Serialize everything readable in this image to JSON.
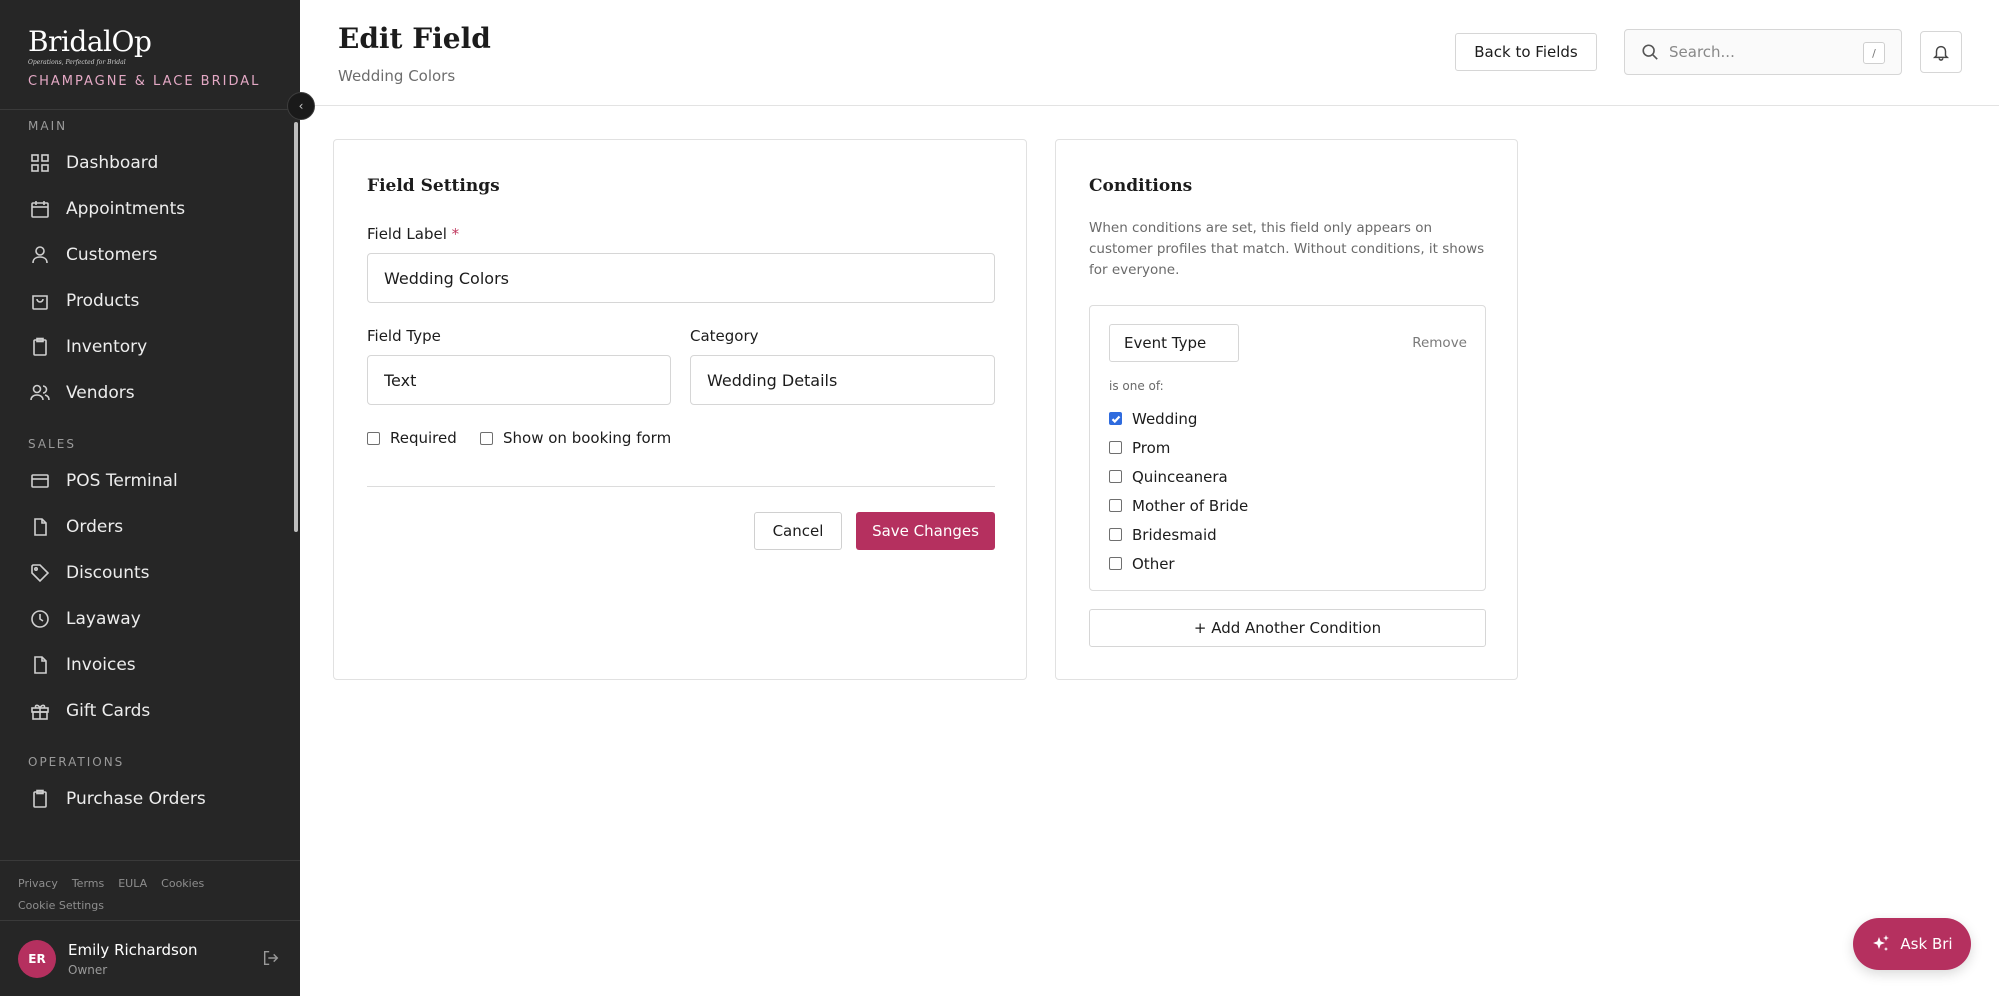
{
  "sidebar": {
    "logo": "BridalOp",
    "tagline": "Operations, Perfected for Bridal",
    "store_name": "CHAMPAGNE & LACE BRIDAL",
    "sections": [
      {
        "label": "MAIN",
        "items": [
          {
            "label": "Dashboard",
            "icon": "grid-icon"
          },
          {
            "label": "Appointments",
            "icon": "calendar-icon"
          },
          {
            "label": "Customers",
            "icon": "user-icon"
          },
          {
            "label": "Products",
            "icon": "shopping-bag-icon"
          },
          {
            "label": "Inventory",
            "icon": "clipboard-icon"
          },
          {
            "label": "Vendors",
            "icon": "users-icon"
          }
        ]
      },
      {
        "label": "SALES",
        "items": [
          {
            "label": "POS Terminal",
            "icon": "credit-card-icon"
          },
          {
            "label": "Orders",
            "icon": "document-icon"
          },
          {
            "label": "Discounts",
            "icon": "tag-icon"
          },
          {
            "label": "Layaway",
            "icon": "clock-icon"
          },
          {
            "label": "Invoices",
            "icon": "file-icon"
          },
          {
            "label": "Gift Cards",
            "icon": "gift-icon"
          }
        ]
      },
      {
        "label": "OPERATIONS",
        "items": [
          {
            "label": "Purchase Orders",
            "icon": "clipboard-icon"
          }
        ]
      }
    ],
    "legal": [
      "Privacy",
      "Terms",
      "EULA",
      "Cookies"
    ],
    "cookie_settings": "Cookie Settings",
    "user": {
      "initials": "ER",
      "name": "Emily Richardson",
      "role": "Owner"
    }
  },
  "header": {
    "title": "Edit Field",
    "subtitle": "Wedding Colors",
    "back_label": "Back to Fields",
    "search_placeholder": "Search...",
    "search_shortcut": "/"
  },
  "field_settings": {
    "title": "Field Settings",
    "label_label": "Field Label",
    "required_mark": "*",
    "label_value": "Wedding Colors",
    "type_label": "Field Type",
    "type_value": "Text",
    "category_label": "Category",
    "category_value": "Wedding Details",
    "required_label": "Required",
    "required_checked": false,
    "booking_label": "Show on booking form",
    "booking_checked": false,
    "cancel_label": "Cancel",
    "save_label": "Save Changes"
  },
  "conditions": {
    "title": "Conditions",
    "description": "When conditions are set, this field only appears on customer profiles that match. Without conditions, it shows for everyone.",
    "condition": {
      "attribute": "Event Type",
      "remove_label": "Remove",
      "operator": "is one of:",
      "options": [
        {
          "label": "Wedding",
          "checked": true
        },
        {
          "label": "Prom",
          "checked": false
        },
        {
          "label": "Quinceanera",
          "checked": false
        },
        {
          "label": "Mother of Bride",
          "checked": false
        },
        {
          "label": "Bridesmaid",
          "checked": false
        },
        {
          "label": "Other",
          "checked": false
        }
      ]
    },
    "add_label": "+ Add Another Condition"
  },
  "assistant": {
    "label": "Ask Bri"
  },
  "colors": {
    "accent": "#b5305f",
    "sidebar_bg": "#262626",
    "checkbox": "#2f6bde"
  }
}
